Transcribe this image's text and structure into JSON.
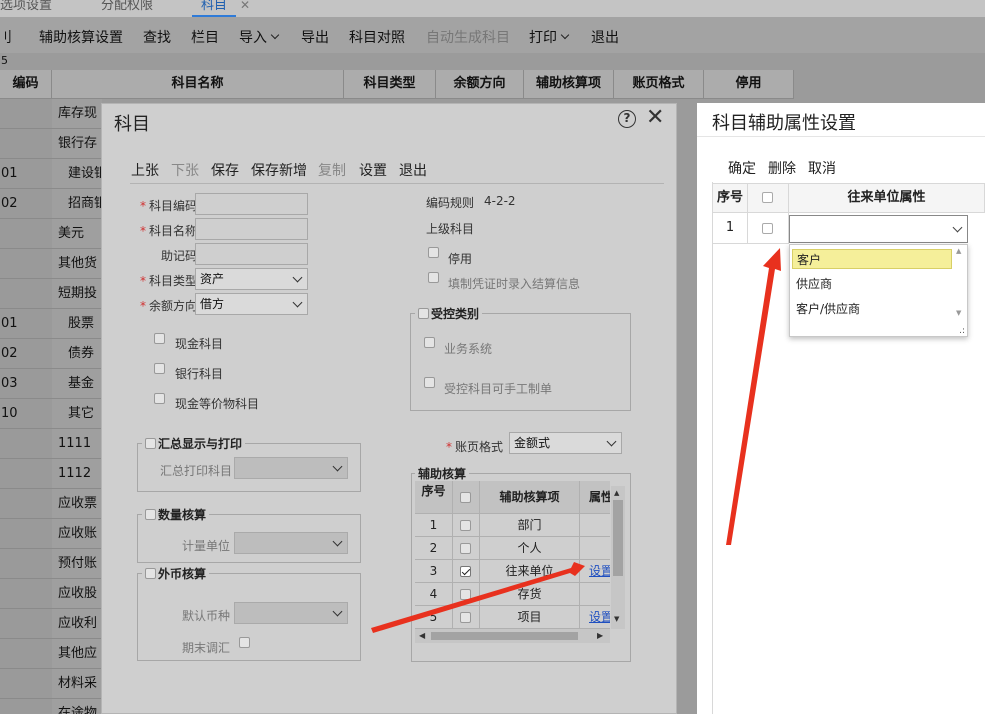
{
  "tabs": [
    {
      "label": "选项设置",
      "active": false
    },
    {
      "label": "分配权限",
      "active": false
    },
    {
      "label": "科目",
      "active": true
    }
  ],
  "tab_close": "✕",
  "toolbar": {
    "items": [
      {
        "label": "刂",
        "dis": false
      },
      {
        "label": "辅助核算设置",
        "dis": false
      },
      {
        "label": "查找",
        "dis": false
      },
      {
        "label": "栏目",
        "dis": false
      },
      {
        "label": "导入",
        "dis": false,
        "dropdown": true
      },
      {
        "label": "导出",
        "dis": false
      },
      {
        "label": "科目对照",
        "dis": false
      },
      {
        "label": "自动生成科目",
        "dis": true
      },
      {
        "label": "打印",
        "dis": false,
        "dropdown": true
      },
      {
        "label": "退出",
        "dis": false
      }
    ]
  },
  "strip_text": "5",
  "grid": {
    "headers": [
      "编码",
      "科目名称",
      "科目类型",
      "余额方向",
      "辅助核算项",
      "账页格式",
      "停用"
    ],
    "codes": [
      "",
      "",
      "01",
      "02",
      "",
      "",
      "",
      "01",
      "02",
      "03",
      "10",
      "",
      "",
      "",
      "",
      "",
      "",
      "",
      "",
      "",
      "",
      ""
    ],
    "names": [
      "库存现",
      "银行存",
      "建设银",
      "招商银",
      "美元",
      "其他货",
      "短期投",
      "股票",
      "债券",
      "基金",
      "其它",
      "1111",
      "1112",
      "应收票",
      "应收账",
      "预付账",
      "应收股",
      "应收利",
      "其他应",
      "材料采",
      "在途物"
    ]
  },
  "dialog": {
    "title": "科目",
    "help": "?",
    "close": "✕",
    "toolbar": [
      {
        "label": "上张",
        "dis": false
      },
      {
        "label": "下张",
        "dis": true
      },
      {
        "label": "保存",
        "dis": false
      },
      {
        "label": "保存新增",
        "dis": false
      },
      {
        "label": "复制",
        "dis": true
      },
      {
        "label": "设置",
        "dis": false
      },
      {
        "label": "退出",
        "dis": false
      }
    ],
    "fields": {
      "code_label": "科目编码",
      "name_label": "科目名称",
      "mnemonic_label": "助记码",
      "type_label": "科目类型",
      "type_value": "资产",
      "balance_label": "余额方向",
      "balance_value": "借方"
    },
    "checkboxes": {
      "cash": "现金科目",
      "bank": "银行科目",
      "cash_eq": "现金等价物科目"
    },
    "rule_label": "编码规则",
    "rule_value": "4-2-2",
    "parent_label": "上级科目",
    "disabled_label": "停用",
    "settle_label": "填制凭证时录入结算信息",
    "controlled": {
      "title": "受控类别",
      "business": "业务系统",
      "manual": "受控科目可手工制单"
    },
    "summary": {
      "title": "汇总显示与打印",
      "print_label": "汇总打印科目"
    },
    "quantity": {
      "title": "数量核算",
      "unit_label": "计量单位"
    },
    "foreign": {
      "title": "外币核算",
      "currency_label": "默认币种",
      "adjust_label": "期末调汇"
    },
    "ledger_label": "账页格式",
    "ledger_value": "金额式",
    "aux": {
      "title": "辅助核算",
      "headers": {
        "seq": "序号",
        "item": "辅助核算项",
        "attr": "属性"
      },
      "rows": [
        {
          "seq": "1",
          "item": "部门",
          "checked": false,
          "attr": ""
        },
        {
          "seq": "2",
          "item": "个人",
          "checked": false,
          "attr": ""
        },
        {
          "seq": "3",
          "item": "往来单位",
          "checked": true,
          "attr": "设置"
        },
        {
          "seq": "4",
          "item": "存货",
          "checked": false,
          "attr": ""
        },
        {
          "seq": "5",
          "item": "项目",
          "checked": false,
          "attr": "设置"
        }
      ]
    }
  },
  "right_panel": {
    "title": "科目辅助属性设置",
    "toolbar": [
      "确定",
      "删除",
      "取消"
    ],
    "headers": {
      "seq": "序号",
      "attr": "往来单位属性"
    },
    "row_seq": "1",
    "dropdown_options": [
      "客户",
      "供应商",
      "客户/供应商"
    ],
    "selected_option": "客户"
  },
  "colors": {
    "arrow": "#e8311e",
    "link": "#1f4fc0",
    "active_tab": "#2f7bd8",
    "highlight": "#f5ef9a"
  }
}
